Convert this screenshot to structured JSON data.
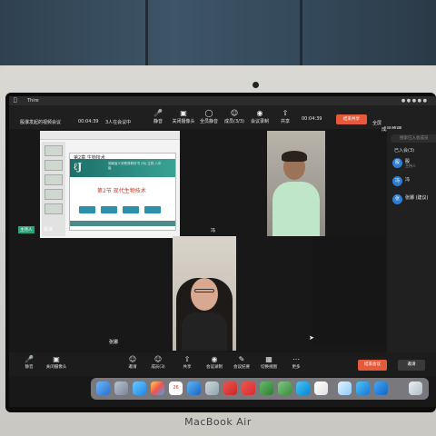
{
  "menubar": {
    "app_name": "Thire"
  },
  "meeting": {
    "title": "殷瀑发起的视频会议",
    "timer": "00:04:39",
    "participant_count": "3人在会议中",
    "timer_right": "00:04:39",
    "end_top_label": "结束共享",
    "fullscreen_label": "全屏",
    "members_tab": "成员管理"
  },
  "top_toolbar": [
    {
      "label": "静音",
      "icon": "mic-icon"
    },
    {
      "label": "关闭摄像头",
      "icon": "camera-icon"
    },
    {
      "label": "全员静音",
      "icon": "mute-all-icon"
    },
    {
      "label": "成员(3/3)",
      "icon": "members-icon"
    },
    {
      "label": "会议录制",
      "icon": "record-icon"
    },
    {
      "label": "共享",
      "icon": "share-icon"
    }
  ],
  "slide": {
    "chapter": "第2章 生物技术",
    "section": "第2节 现代生物技术",
    "band_text": "湖南省义务教育教科书 (RJ) 生物 八年级"
  },
  "tiles": {
    "host_badge": "主持人",
    "host_name": "殷瀑",
    "name_a": "冯",
    "name_b": "张娜"
  },
  "panel": {
    "search_placeholder": "搜索已入会成员",
    "joined_label": "已入会(3)",
    "members": [
      {
        "avatar": "殷",
        "name": "殷",
        "role": "主持人"
      },
      {
        "avatar": "冯",
        "name": "冯",
        "role": ""
      },
      {
        "avatar": "张",
        "name": "张娜 (建议)",
        "role": ""
      }
    ]
  },
  "bottom_toolbar": [
    {
      "label": "静音",
      "icon": "mic-icon"
    },
    {
      "label": "关闭摄像头",
      "icon": "camera-icon"
    },
    {
      "label": "邀请",
      "icon": "invite-icon"
    },
    {
      "label": "成员(3)",
      "icon": "members-icon"
    },
    {
      "label": "共享",
      "icon": "share-icon"
    },
    {
      "label": "会议录制",
      "icon": "record-icon"
    },
    {
      "label": "会议纪要",
      "icon": "notes-icon"
    },
    {
      "label": "切换视图",
      "icon": "view-icon"
    },
    {
      "label": "更多",
      "icon": "more-icon"
    }
  ],
  "bottom_buttons": {
    "end_label": "结束会议",
    "invite_label": "邀请"
  },
  "dock": {
    "calendar_day": "26"
  },
  "laptop_brand": "MacBook Air",
  "colors": {
    "accent_red": "#e55a3a",
    "host_green": "#2aa57a",
    "avatar_blue": "#2f7dd1"
  }
}
